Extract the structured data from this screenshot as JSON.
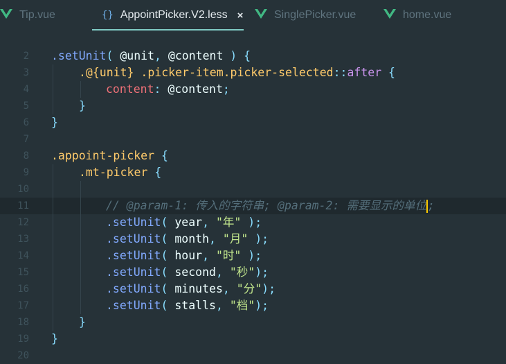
{
  "tabs": [
    {
      "label": "Tip.vue",
      "icon": "vue-icon",
      "active": false
    },
    {
      "label": "AppointPicker.V2.less",
      "icon": "braces-icon",
      "active": true
    },
    {
      "label": "SinglePicker.vue",
      "icon": "vue-icon",
      "active": false
    },
    {
      "label": "home.vue",
      "icon": "vue-icon",
      "active": false
    }
  ],
  "active_tab_close": "×",
  "braces_glyph": "{}",
  "line_numbers": [
    "2",
    "3",
    "4",
    "5",
    "6",
    "7",
    "8",
    "9",
    "10",
    "11",
    "12",
    "13",
    "14",
    "15",
    "16",
    "17",
    "18",
    "19",
    "20"
  ],
  "code": {
    "l2": [
      ".setUnit",
      "(",
      " @unit",
      ",",
      " @content",
      " )",
      " {"
    ],
    "l3": [
      ".@{unit}",
      " .picker-item.picker-selected",
      "::",
      "after",
      " {"
    ],
    "l4": [
      "content",
      ":",
      " @content",
      ";"
    ],
    "l5": [
      "}"
    ],
    "l6": [
      "}"
    ],
    "l8": [
      ".appoint-picker",
      " {"
    ],
    "l9": [
      ".mt-picker",
      " {"
    ],
    "l11": [
      "// @param-1: 传入的字符串; @param-2: 需要显示的单位",
      ";"
    ],
    "l12": [
      ".setUnit",
      "(",
      " year",
      ",",
      " \"年\"",
      " );"
    ],
    "l13": [
      ".setUnit",
      "(",
      " month",
      ",",
      " \"月\"",
      " );"
    ],
    "l14": [
      ".setUnit",
      "(",
      " hour",
      ",",
      " \"时\"",
      " );"
    ],
    "l15": [
      ".setUnit",
      "(",
      " second",
      ",",
      " \"秒\"",
      ");"
    ],
    "l16": [
      ".setUnit",
      "(",
      " minutes",
      ",",
      " \"分\"",
      ");"
    ],
    "l17": [
      ".setUnit",
      "(",
      " stalls",
      ",",
      " \"档\"",
      ");"
    ],
    "l18": [
      "}"
    ],
    "l19": [
      "}"
    ]
  },
  "colors": {
    "background": "#263238",
    "accent": "#80cbc4",
    "cursor": "#ffcc00"
  }
}
